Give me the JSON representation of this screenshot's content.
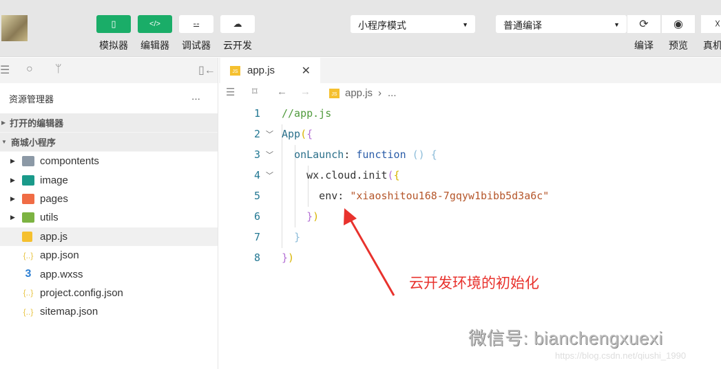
{
  "toolbar": {
    "buttons": [
      {
        "label": "模拟器",
        "icon": "phone-icon",
        "active": true
      },
      {
        "label": "编辑器",
        "icon": "code-icon",
        "active": true
      },
      {
        "label": "调试器",
        "icon": "sliders-icon",
        "active": false
      },
      {
        "label": "云开发",
        "icon": "cloud-icon",
        "active": false
      }
    ],
    "mode_select": "小程序模式",
    "compile_select": "普通编译",
    "actions": [
      {
        "label": "编译",
        "icon": "refresh-icon"
      },
      {
        "label": "预览",
        "icon": "eye-icon"
      },
      {
        "label": "真机",
        "icon": "debug-icon"
      }
    ],
    "accent": "#1aad68"
  },
  "sidebar": {
    "title": "资源管理器",
    "more": "···",
    "sections": [
      "打开的编辑器",
      "商城小程序"
    ],
    "items": [
      {
        "name": "compontents",
        "type": "folder",
        "color": "#8c99a6"
      },
      {
        "name": "image",
        "type": "folder",
        "color": "#1a9a8a"
      },
      {
        "name": "pages",
        "type": "folder",
        "color": "#f06c45"
      },
      {
        "name": "utils",
        "type": "folder",
        "color": "#7cb342"
      },
      {
        "name": "app.js",
        "type": "js",
        "color": "#f5c02f"
      },
      {
        "name": "app.json",
        "type": "json",
        "color": "#e8c547"
      },
      {
        "name": "app.wxss",
        "type": "css",
        "color": "#2d7fd3"
      },
      {
        "name": "project.config.json",
        "type": "json",
        "color": "#e8c547"
      },
      {
        "name": "sitemap.json",
        "type": "json",
        "color": "#e8c547"
      }
    ]
  },
  "editor": {
    "tab": "app.js",
    "breadcrumb": [
      "app.js",
      "..."
    ],
    "js_badge": "JS",
    "lines": [
      {
        "n": "1",
        "parts": [
          [
            "cm",
            "//app.js"
          ]
        ]
      },
      {
        "n": "2",
        "fold": true,
        "parts": [
          [
            "fn",
            "App"
          ],
          [
            "yl",
            "("
          ],
          [
            "pn",
            "{"
          ]
        ]
      },
      {
        "n": "3",
        "fold": true,
        "parts": [
          [
            "pl",
            "  "
          ],
          [
            "fn",
            "onLaunch"
          ],
          [
            "pl",
            ": "
          ],
          [
            "kw",
            "function"
          ],
          [
            "pl",
            " "
          ],
          [
            "bl",
            "() {"
          ]
        ]
      },
      {
        "n": "4",
        "fold": true,
        "parts": [
          [
            "pl",
            "    "
          ],
          [
            "pl",
            "wx.cloud.init"
          ],
          [
            "pn",
            "("
          ],
          [
            "yl",
            "{"
          ]
        ]
      },
      {
        "n": "5",
        "parts": [
          [
            "pl",
            "      env: "
          ],
          [
            "st",
            "\"xiaoshitou168-7gqyw1bibb5d3a6c\""
          ]
        ]
      },
      {
        "n": "6",
        "parts": [
          [
            "pl",
            "    "
          ],
          [
            "pn",
            "}"
          ],
          [
            "yl",
            ")"
          ]
        ]
      },
      {
        "n": "7",
        "parts": [
          [
            "pl",
            "  "
          ],
          [
            "bl",
            "}"
          ]
        ]
      },
      {
        "n": "8",
        "parts": [
          [
            "pn",
            "}"
          ],
          [
            "yl",
            ")"
          ]
        ]
      }
    ]
  },
  "annotation": "云开发环境的初始化",
  "watermark": {
    "text": "微信号: bianchengxuexi",
    "url": "https://blog.csdn.net/qiushi_1990"
  }
}
